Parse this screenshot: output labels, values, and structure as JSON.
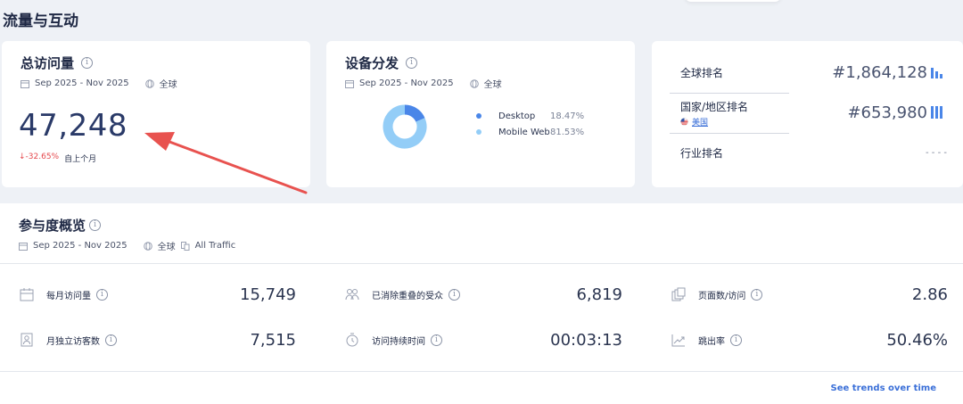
{
  "section_title": "流量与互动",
  "date_range": "Sep 2025 - Nov 2025",
  "region": "全球",
  "visits_card": {
    "title": "总访问量",
    "value": "47,248",
    "change": "↓-32.65%",
    "change_label": "自上个月"
  },
  "device_card": {
    "title": "设备分发",
    "chart_data": {
      "type": "pie",
      "categories": [
        "Desktop",
        "Mobile Web"
      ],
      "values": [
        18.47,
        81.53
      ],
      "labels": [
        "18.47%",
        "81.53%"
      ],
      "colors": [
        "#4a86e8",
        "#93cdf7"
      ]
    }
  },
  "rank_card": {
    "global_label": "全球排名",
    "global_value": "#1,864,128",
    "country_label": "国家/地区排名",
    "country_name": "美国",
    "country_value": "#653,980",
    "industry_label": "行业排名",
    "industry_value": "- - - -"
  },
  "engagement": {
    "title": "参与度概览",
    "traffic": "All Traffic",
    "metrics": [
      {
        "label": "每月访问量",
        "value": "15,749",
        "icon": "calendar-icon"
      },
      {
        "label": "已消除重叠的受众",
        "value": "6,819",
        "icon": "users-icon"
      },
      {
        "label": "页面数/访问",
        "value": "2.86",
        "icon": "pages-icon"
      },
      {
        "label": "月独立访客数",
        "value": "7,515",
        "icon": "id-card-icon"
      },
      {
        "label": "访问持续时间",
        "value": "00:03:13",
        "icon": "clock-icon"
      },
      {
        "label": "跳出率",
        "value": "50.46%",
        "icon": "bounce-icon"
      }
    ],
    "trend_link": "See trends over time"
  },
  "colors": {
    "accent": "#4a86e8",
    "negative": "#e5484d",
    "arrow": "#e8524f"
  }
}
